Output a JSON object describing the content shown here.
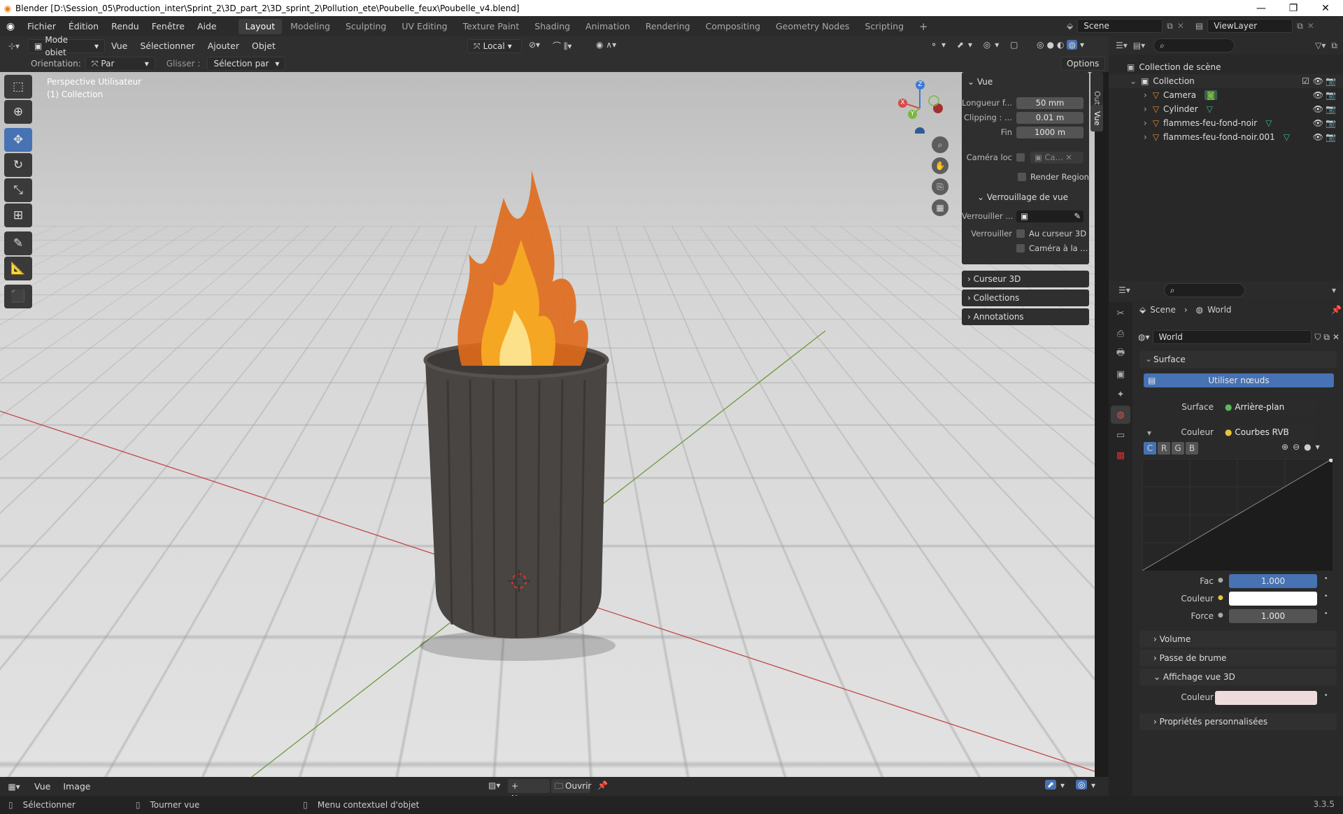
{
  "window": {
    "title": "Blender [D:\\Session_05\\Production_inter\\Sprint_2\\3D_part_2\\3D_sprint_2\\Pollution_ete\\Poubelle_feux\\Poubelle_v4.blend]"
  },
  "menu": [
    "Fichier",
    "Édition",
    "Rendu",
    "Fenêtre",
    "Aide"
  ],
  "workspaces": [
    "Layout",
    "Modeling",
    "Sculpting",
    "UV Editing",
    "Texture Paint",
    "Shading",
    "Animation",
    "Rendering",
    "Compositing",
    "Geometry Nodes",
    "Scripting"
  ],
  "scene": {
    "name": "Scene",
    "view_layer": "ViewLayer"
  },
  "viewport_header": {
    "mode": "Mode objet",
    "menus": [
      "Vue",
      "Sélectionner",
      "Ajouter",
      "Objet"
    ],
    "transform": "Local"
  },
  "tool_settings": {
    "orientation_label": "Orientation:",
    "orientation": "Par défaut",
    "drag_label": "Glisser :",
    "drag": "Sélection par boît",
    "options": "Options"
  },
  "viewport": {
    "view_name": "Perspective Utilisateur",
    "collection": "(1) Collection"
  },
  "gizmo": {
    "x": "X",
    "y": "Y",
    "z": "Z"
  },
  "side_tabs": [
    "Outil",
    "Vue"
  ],
  "npanel": {
    "vue_header": "Vue",
    "focal_label": "Longueur f...",
    "focal_value": "50 mm",
    "clip_label": "Clipping : ...",
    "clip_start": "0.01 m",
    "end_label": "Fin",
    "clip_end": "1000 m",
    "camloc_label": "Caméra loc",
    "camloc_value": "Ca...",
    "render_region": "Render Region",
    "lock_header": "Verrouillage de vue",
    "lock_obj_label": "Verrouiller ...",
    "lock_label": "Verrouiller",
    "lock_cursor": "Au curseur 3D",
    "lock_camera": "Caméra à la ...",
    "sections": [
      "Curseur 3D",
      "Collections",
      "Annotations"
    ]
  },
  "outliner": {
    "root": "Collection de scène",
    "collection": "Collection",
    "items": [
      "Camera",
      "Cylinder",
      "flammes-feu-fond-noir",
      "flammes-feu-fond-noir.001"
    ]
  },
  "properties": {
    "breadcrumb": [
      "Scene",
      "World"
    ],
    "world_name": "World",
    "surface_header": "Surface",
    "use_nodes": "Utiliser nœuds",
    "surface_label": "Surface",
    "surface_value": "Arrière-plan",
    "color_label": "Couleur",
    "color_value": "Courbes RVB",
    "channels": [
      "C",
      "R",
      "G",
      "B"
    ],
    "fac_label": "Fac",
    "fac_value": "1.000",
    "color2_label": "Couleur",
    "force_label": "Force",
    "force_value": "1.000",
    "sections": [
      "Volume",
      "Passe de brume"
    ],
    "viewport_display": "Affichage vue 3D",
    "vd_color_label": "Couleur",
    "custom_props": "Propriétés personnalisées"
  },
  "colors": {
    "accent": "#4772b3",
    "world_color": "#ffffff",
    "vd_color": "#eedcdc"
  },
  "bottom_editor": {
    "menus": [
      "Vue",
      "Image"
    ],
    "new": "+ Nouve...",
    "open": "Ouvrir"
  },
  "status": {
    "select": "Sélectionner",
    "rotate": "Tourner vue",
    "context": "Menu contextuel d'objet",
    "version": "3.3.5"
  }
}
